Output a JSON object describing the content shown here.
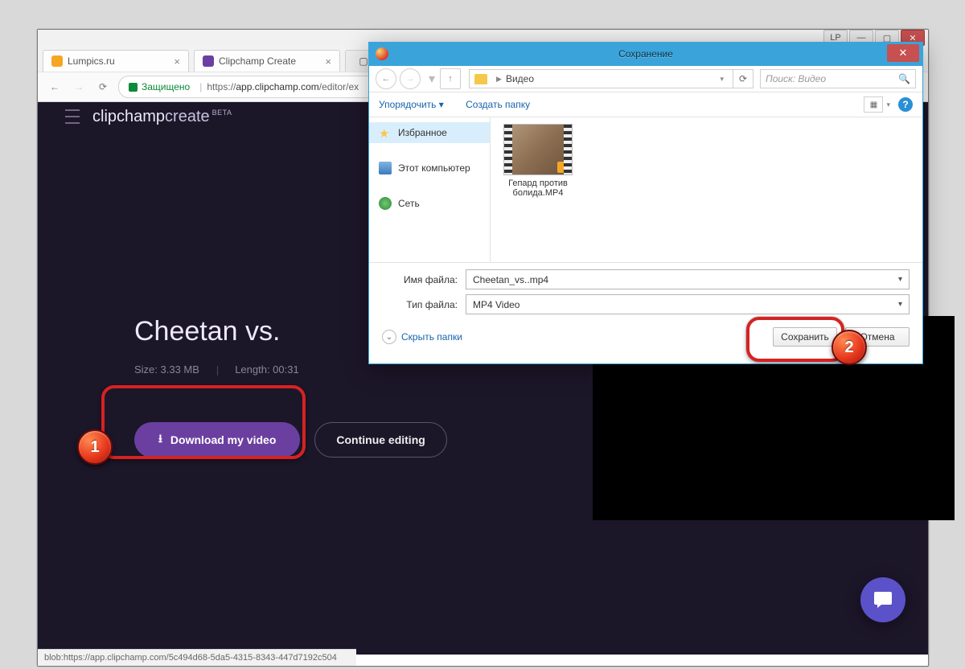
{
  "browser": {
    "tabs": [
      {
        "title": "Lumpics.ru"
      },
      {
        "title": "Clipchamp Create"
      }
    ],
    "nav": {
      "secure_label": "Защищено",
      "url_prefix": "https://",
      "url_domain": "app.clipchamp.com",
      "url_path": "/editor/ex"
    },
    "status": "blob:https://app.clipchamp.com/5c494d68-5da5-4315-8343-447d7192c504"
  },
  "page": {
    "logo_main": "clipchamp",
    "logo_sub": "create",
    "logo_beta": "BETA",
    "title": "Cheetan vs.",
    "size_label": "Size: 3.33 MB",
    "length_label": "Length: 00:31",
    "download_label": "Download my video",
    "continue_label": "Continue editing"
  },
  "dialog": {
    "title": "Сохранение",
    "breadcrumb": "Видео",
    "search_placeholder": "Поиск: Видео",
    "tools": {
      "organize": "Упорядочить ▾",
      "new_folder": "Создать папку"
    },
    "sidebar": {
      "favorites": "Избранное",
      "computer": "Этот компьютер",
      "network": "Сеть"
    },
    "file_item": "Гепард против болида.MP4",
    "filename_label": "Имя файла:",
    "filename_value": "Cheetan_vs..mp4",
    "filetype_label": "Тип файла:",
    "filetype_value": "MP4 Video",
    "hide_folders": "Скрыть папки",
    "save": "Сохранить",
    "cancel": "Отмена"
  },
  "callouts": {
    "c1": "1",
    "c2": "2"
  }
}
